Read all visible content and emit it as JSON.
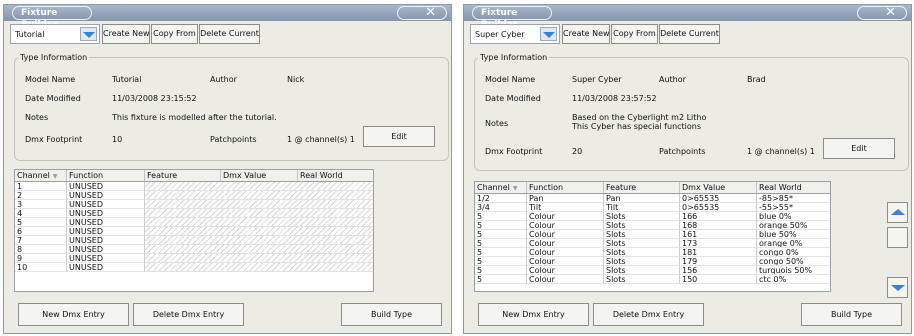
{
  "left": {
    "title": "Fixture Builder",
    "close_icon": "close-icon",
    "fixture_select": "Tutorial",
    "toolbar": {
      "create_new": "Create New",
      "copy_from": "Copy From",
      "delete_current": "Delete Current"
    },
    "type_info": {
      "group_title": "Type Information",
      "model_name_label": "Model Name",
      "model_name": "Tutorial",
      "author_label": "Author",
      "author": "Nick",
      "date_label": "Date Modified",
      "date": "11/03/2008 23:15:52",
      "notes_label": "Notes",
      "notes_line1": "This fixture is modelled after the tutorial.",
      "dmx_footprint_label": "Dmx Footprint",
      "dmx_footprint": "10",
      "patchpoints_label": "Patchpoints",
      "patchpoints": "1 @ channel(s) 1",
      "edit": "Edit"
    },
    "table": {
      "headers": [
        "Channel",
        "Function",
        "Feature",
        "Dmx Value",
        "Real World"
      ],
      "rows": [
        [
          "1",
          "UNUSED"
        ],
        [
          "2",
          "UNUSED"
        ],
        [
          "3",
          "UNUSED"
        ],
        [
          "4",
          "UNUSED"
        ],
        [
          "5",
          "UNUSED"
        ],
        [
          "6",
          "UNUSED"
        ],
        [
          "7",
          "UNUSED"
        ],
        [
          "8",
          "UNUSED"
        ],
        [
          "9",
          "UNUSED"
        ],
        [
          "10",
          "UNUSED"
        ]
      ]
    },
    "buttons": {
      "new_dmx": "New Dmx Entry",
      "delete_dmx": "Delete Dmx Entry",
      "build_type": "Build Type"
    }
  },
  "right": {
    "title": "Fixture Builder",
    "close_icon": "close-icon",
    "fixture_select": "Super Cyber",
    "toolbar": {
      "create_new": "Create New",
      "copy_from": "Copy From",
      "delete_current": "Delete Current"
    },
    "type_info": {
      "group_title": "Type Information",
      "model_name_label": "Model Name",
      "model_name": "Super Cyber",
      "author_label": "Author",
      "author": "Brad",
      "date_label": "Date Modified",
      "date": "11/03/2008 23:57:52",
      "notes_label": "Notes",
      "notes_line1": "Based on the Cyberlight m2 Litho",
      "notes_line2": "This Cyber has special functions",
      "dmx_footprint_label": "Dmx Footprint",
      "dmx_footprint": "20",
      "patchpoints_label": "Patchpoints",
      "patchpoints": "1 @ channel(s) 1",
      "edit": "Edit"
    },
    "table": {
      "headers": [
        "Channel",
        "Function",
        "Feature",
        "Dmx Value",
        "Real World"
      ],
      "rows": [
        [
          "1/2",
          "Pan",
          "Pan",
          "0>65535",
          "-85>85*"
        ],
        [
          "3/4",
          "Tilt",
          "Tilt",
          "0>65535",
          "-55>55*"
        ],
        [
          "5",
          "Colour",
          "Slots",
          "166",
          "blue 0%"
        ],
        [
          "5",
          "Colour",
          "Slots",
          "168",
          "orange 50%"
        ],
        [
          "5",
          "Colour",
          "Slots",
          "161",
          "blue 50%"
        ],
        [
          "5",
          "Colour",
          "Slots",
          "173",
          "orange 0%"
        ],
        [
          "5",
          "Colour",
          "Slots",
          "181",
          "congo 0%"
        ],
        [
          "5",
          "Colour",
          "Slots",
          "179",
          "congo 50%"
        ],
        [
          "5",
          "Colour",
          "Slots",
          "156",
          "turquois 50%"
        ],
        [
          "5",
          "Colour",
          "Slots",
          "150",
          "ctc 0%"
        ]
      ]
    },
    "buttons": {
      "new_dmx": "New Dmx Entry",
      "delete_dmx": "Delete Dmx Entry",
      "build_type": "Build Type"
    }
  }
}
